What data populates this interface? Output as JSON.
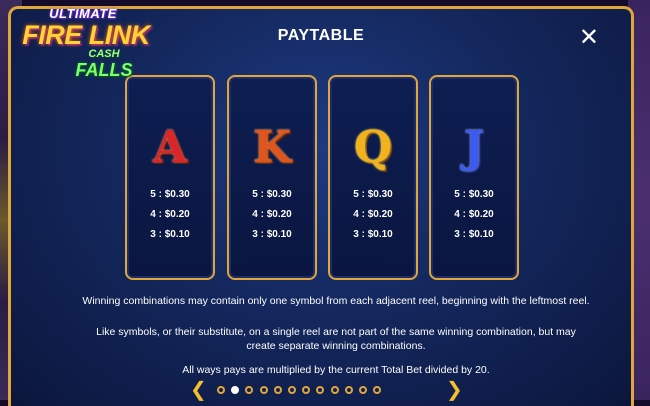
{
  "game": {
    "logo": {
      "line1": "ULTIMATE",
      "line2": "FIRE LINK",
      "line3": "CASH",
      "line4": "FALLS"
    }
  },
  "paytable": {
    "title": "PAYTABLE",
    "close_label": "✕",
    "cards": [
      {
        "symbol": "A",
        "symbol_color": "#d8262a",
        "pays": [
          "5 : $0.30",
          "4 : $0.20",
          "3 : $0.10"
        ]
      },
      {
        "symbol": "K",
        "symbol_color": "#e0541e",
        "pays": [
          "5 : $0.30",
          "4 : $0.20",
          "3 : $0.10"
        ]
      },
      {
        "symbol": "Q",
        "symbol_color": "#f2b21e",
        "pays": [
          "5 : $0.30",
          "4 : $0.20",
          "3 : $0.10"
        ]
      },
      {
        "symbol": "J",
        "symbol_color": "#3a5af0",
        "pays": [
          "5 : $0.30",
          "4 : $0.20",
          "3 : $0.10"
        ]
      }
    ],
    "rules": [
      "Winning combinations may contain only one symbol from each adjacent reel, beginning with the leftmost reel.",
      "Like symbols, or their substitute, on a single reel are not part of the same winning combination, but may create separate winning combinations.",
      "All ways pays are multiplied by the current Total Bet divided by 20."
    ]
  },
  "pager": {
    "prev_icon": "chevron-left",
    "next_icon": "chevron-right",
    "prev_label": "❮",
    "next_label": "❯",
    "page_count": 12,
    "current_page": 2
  },
  "colors": {
    "accent_gold": "#e0a63a",
    "panel_blue": "#14285e",
    "text": "#ffffff"
  }
}
